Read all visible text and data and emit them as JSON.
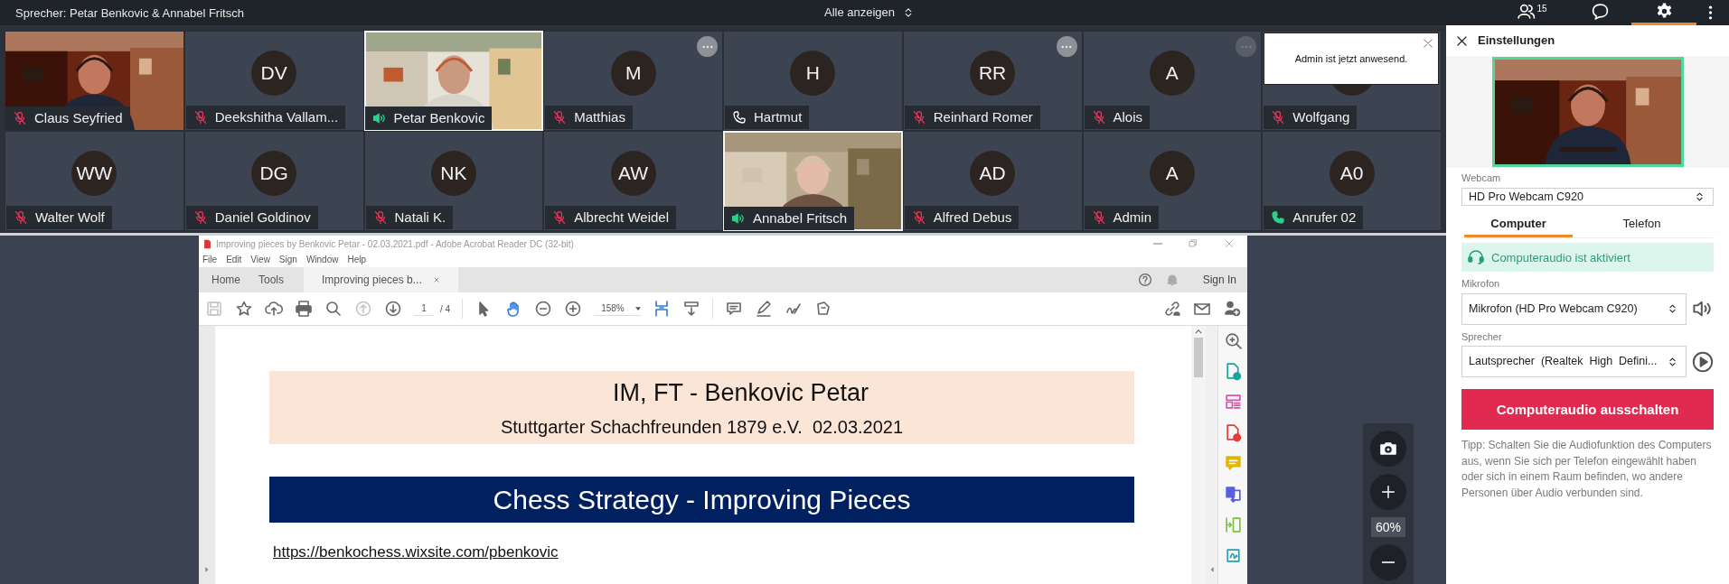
{
  "top_bar": {
    "speakers": "Sprecher: Petar Benkovic & Annabel Fritsch",
    "view_selector": "Alle anzeigen",
    "tabs": [
      {
        "kind": "participants",
        "count": "15",
        "selected": false
      },
      {
        "kind": "chat",
        "selected": false
      },
      {
        "kind": "settings",
        "selected": true
      }
    ]
  },
  "tiles": [
    {
      "kind": "video",
      "name": "Claus Seyfried",
      "audio": {
        "kind": "muted"
      },
      "active_speaker": false
    },
    {
      "kind": "avatar",
      "initials": "DV",
      "name": "Deekshitha Vallam...",
      "audio": {
        "kind": "muted"
      },
      "active_speaker": false
    },
    {
      "kind": "video",
      "name": "Petar Benkovic",
      "audio": {
        "kind": "speaking"
      },
      "active_speaker": true
    },
    {
      "kind": "avatar",
      "initials": "M",
      "name": "Matthias",
      "audio": {
        "kind": "muted"
      },
      "active_speaker": false,
      "menu_button": {
        "dimmed": false
      }
    },
    {
      "kind": "avatar",
      "initials": "H",
      "name": "Hartmut",
      "audio": {
        "kind": "phone"
      },
      "active_speaker": false
    },
    {
      "kind": "avatar",
      "initials": "RR",
      "name": "Reinhard Romer",
      "audio": {
        "kind": "muted"
      },
      "active_speaker": false,
      "menu_button": {
        "dimmed": false
      }
    },
    {
      "kind": "avatar",
      "initials": "A",
      "name": "Alois",
      "audio": {
        "kind": "muted"
      },
      "active_speaker": false,
      "menu_button": {
        "dimmed": true
      }
    },
    {
      "kind": "avatar",
      "name": "Wolfgang",
      "audio": {
        "kind": "muted"
      },
      "active_speaker": false
    },
    {
      "kind": "avatar",
      "initials": "WW",
      "name": "Walter Wolf",
      "audio": {
        "kind": "muted"
      },
      "active_speaker": false
    },
    {
      "kind": "avatar",
      "initials": "DG",
      "name": "Daniel Goldinov",
      "audio": {
        "kind": "muted"
      },
      "active_speaker": false
    },
    {
      "kind": "avatar",
      "initials": "NK",
      "name": "Natali K.",
      "audio": {
        "kind": "muted"
      },
      "active_speaker": false
    },
    {
      "kind": "avatar",
      "initials": "AW",
      "name": "Albrecht Weidel",
      "audio": {
        "kind": "muted"
      },
      "active_speaker": false
    },
    {
      "kind": "video",
      "name": "Annabel Fritsch",
      "audio": {
        "kind": "speaking"
      },
      "active_speaker": true
    },
    {
      "kind": "avatar",
      "initials": "AD",
      "name": "Alfred Debus",
      "audio": {
        "kind": "muted"
      },
      "active_speaker": false
    },
    {
      "kind": "avatar",
      "initials": "A",
      "name": "Admin",
      "audio": {
        "kind": "muted"
      },
      "active_speaker": false
    },
    {
      "kind": "avatar",
      "initials": "A0",
      "name": "Anrufer 02",
      "audio": {
        "kind": "phone_active"
      },
      "active_speaker": false
    }
  ],
  "notification": {
    "text": "Admin ist jetzt anwesend."
  },
  "acrobat": {
    "title": "Improving pieces by Benkovic Petar - 02.03.2021.pdf - Adobe Acrobat Reader DC (32-bit)",
    "menu": [
      "File",
      "Edit",
      "View",
      "Sign",
      "Window",
      "Help"
    ],
    "tabs": [
      {
        "label": "Home",
        "selected": false
      },
      {
        "label": "Tools",
        "selected": false
      },
      {
        "label": "Improving pieces b...",
        "selected": true
      }
    ],
    "sign_in": "Sign In",
    "page": "1",
    "page_total": "/ 4",
    "zoom": "158%",
    "document": {
      "title": "IM, FT - Benkovic Petar",
      "subtitle": "Stuttgarter Schachfreunden 1879 e.V.  02.03.2021",
      "heading": "Chess Strategy - Improving Pieces",
      "link": "https://benkochess.wixsite.com/pbenkovic"
    }
  },
  "share_zoom": "60%",
  "settings": {
    "title": "Einstellungen",
    "webcam_label": "Webcam",
    "webcam": "HD Pro Webcam C920",
    "audio_tabs": [
      {
        "label": "Computer",
        "selected": true
      },
      {
        "label": "Telefon",
        "selected": false
      }
    ],
    "status": "Computeraudio ist aktiviert",
    "mic_label": "Mikrofon",
    "mic": "Mikrofon (HD Pro Webcam C920)",
    "speaker_label": "Sprecher",
    "speaker": "Lautsprecher  (Realtek  High  Defini...",
    "button": "Computeraudio ausschalten",
    "tip": "Tipp: Schalten Sie die Audiofunktion des Computers aus, wenn Sie sich per Telefon eingewählt haben oder sich in einem Raum befinden, wo andere Personen über Audio verbunden sind."
  }
}
